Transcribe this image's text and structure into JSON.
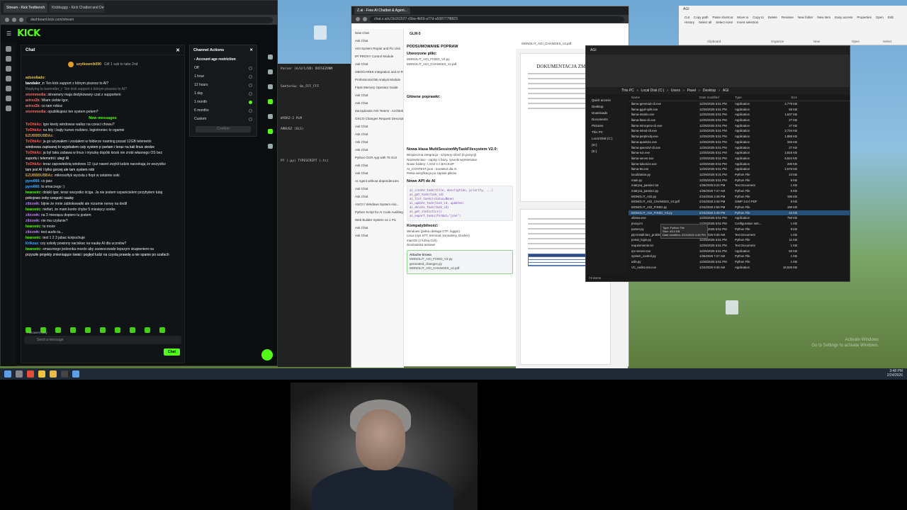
{
  "kick": {
    "tabs": [
      "Stream - Kick Testbench",
      "Kickbuggy - Kick Chatbot and Dev"
    ],
    "address": "dashboard.kick.com/stream",
    "logo": "KICK",
    "chat_title": "Chat",
    "pinned_user": "uzytkownik090",
    "pinned_text": "Gift 1 sub to take 2nd",
    "messages": [
      {
        "user": "adsoo6ado:",
        "text": " ",
        "color": "#e8c84a"
      },
      {
        "user": "bandaler_r:",
        "text": "Ten kick support z którym piszesz to AI?",
        "color": "#ffffff"
      },
      {
        "user": "",
        "text": "Replying to bamndler_r: Ten kick support z którym piszesz to AI?",
        "color": "#888888"
      },
      {
        "user": "stormmedia:",
        "text": "streamery maja dedykowany czat z supportem",
        "color": "#ff6b6b"
      },
      {
        "user": "artrez2b:",
        "text": "Wiam ciebie Igor,",
        "color": "#ff6b6b"
      },
      {
        "user": "artrez2b:",
        "text": "co tam robisz",
        "color": "#ff6b6b"
      },
      {
        "user": "stormmedia:",
        "text": "opublikujesz ten system potem?",
        "color": "#ff6b6b"
      }
    ],
    "new_messages": "New messages",
    "messages2": [
      {
        "user": "ToOhkAz:",
        "text": "Igor kiedy windowse walisz na czesci chowu?",
        "color": "#ff5c5c"
      },
      {
        "user": "ToOhkAz:",
        "text": "na bity i bajty kurwo rozbierz, logiotroniec to ogamie",
        "color": "#ff5c5c"
      },
      {
        "user": "EZUBBBUBBAz:",
        "text": " ",
        "color": "#c8a050"
      },
      {
        "user": "ToOhkAz:",
        "text": "ja go używałem i zostałem w folderze roaming pozad 12GB telemetrii",
        "color": "#ff5c5c"
      },
      {
        "user": "",
        "text": "windowsa zapisanej to wyjebalem caly system p partam i teraz na kali linux siedze",
        "color": "#ffffff"
      },
      {
        "user": "ToOhkAz:",
        "text": "ja byl taka zabawa w linux i myszkę dopóki kiosk nie zrobi własnego OS bez",
        "color": "#ff5c5c"
      },
      {
        "user": "",
        "text": "suportu i telemetrii i uleg! AI",
        "color": "#ffffff"
      },
      {
        "user": "ToOhkAz:",
        "text": "teraz zapowiedzią windows 12 i już nawet zwykli ludzie narzekają że wszystko",
        "color": "#ff5c5c"
      },
      {
        "user": "",
        "text": "tam jest AI i tylko gorzej ale tam system robi",
        "color": "#ffffff"
      },
      {
        "user": "EZUBBBUBBAz:",
        "text": "mikrosoftyk wycisła z fiopt w ostatnie soki",
        "color": "#c8a050"
      },
      {
        "user": "pyro660:",
        "text": "co jasz",
        "color": "#4ab0ff"
      },
      {
        "user": "pyro660:",
        "text": "to smaczego :)",
        "color": "#4ab0ff"
      },
      {
        "user": "lwansnic:",
        "text": "dzięki Igor, teraz wszystko ściga. Ja nie jestem szpanicielem przybytem tutaj",
        "color": "#53fc18"
      },
      {
        "user": "",
        "text": "pokojowo żeby czegość naukę",
        "color": "#ffffff"
      },
      {
        "user": "zibizwik:",
        "text": "bijnie że mnie zablokowalki ale rozumie nerwy na dedil",
        "color": "#b77cff"
      },
      {
        "user": "lwansnic:",
        "text": "niefart, że mam konto chybe 5 miesięcy sonke",
        "color": "#53fc18"
      },
      {
        "user": "zibizwik:",
        "text": "na 3 miesiąca dopiero tu jestem",
        "color": "#b77cff"
      },
      {
        "user": "zibizwik:",
        "text": "nie ma czytanie?",
        "color": "#b77cff"
      },
      {
        "user": "lwansnic:",
        "text": "tu może",
        "color": "#53fc18"
      },
      {
        "user": "zibizwik:",
        "text": "test audio ta...",
        "color": "#b77cff"
      },
      {
        "user": "lwansnic:",
        "text": "test 1 2 3 jabac korpochuje",
        "color": "#53fc18"
      },
      {
        "user": "Krikzuz:",
        "text": "czy szkoły powinny naciskac na naukę AI dla uczniów?",
        "color": "#4ab0ff"
      },
      {
        "user": "lwansnic:",
        "text": "smacznego jedzonka mordo aby zaowocowało lepszym skupieniem na",
        "color": "#53fc18"
      },
      {
        "user": "",
        "text": "przyszłe projekty zmieniające świat i pogłęd ludzi na czystą prawdę a nie spanie po szafach",
        "color": "#ffffff"
      }
    ],
    "followers_only": "Followers only",
    "input_placeholder": "Send a message",
    "chat_button": "Chat",
    "actions_title": "Channel Actions",
    "actions_sub": "Account age restriction",
    "actions": [
      "Off",
      "1 hour",
      "12 hours",
      "1 day",
      "1 month",
      "6 months",
      "Custom"
    ],
    "actions_selected": 4,
    "confirm": "Confirm",
    "save_label": "Save"
  },
  "zai": {
    "title": "Z.ai - Free AI Chatbot & Agent...",
    "address": "chat.z.ai/c/1b161527-c5ba-4b59-a77d-a508777f8823",
    "model": "GLM-5",
    "sidebar": [
      "New Chat",
      "Ask Chat",
      "AGI System Repair and Fix Unit",
      "IP/ PROXY Control Module",
      "Ask Chat",
      "OBOCIAREK Integration and AI Re...",
      "Professional DB Analyst Module",
      "Flask Memory Operator Guide",
      "Ask Chat",
      "Ask Chat",
      "Zarządzanie AGI Teams - Architek...",
      "OSCO Changes Request Descriptor",
      "Ask Chat",
      "Ask Chat",
      "Ask Chat",
      "Ask Chat",
      "Python OCR App with Tk GUI",
      "Ask Chat",
      "Ask Chat",
      "AI Agent without dependencies",
      "Ask Chat",
      "Ask Chat",
      "ASCII / Windows System Ass...",
      "Python Script for AI Code Auditing",
      "Web Builder System v4.1 Pic",
      "Ask Chat",
      "Ask Chat"
    ],
    "h1": "PODSUMOWANIE POPRAW",
    "h2": "Utworzone pliki:",
    "h3": "Główne poprawki:",
    "h4": "Nowa klasa MultiSessionMyTaskFilesystem V2.0:",
    "bullets": [
      "Bezpieczna integracja - sztywny rdzeń (5 pozycji)",
      "Nazewnictwo - zapisy z bazy, rysunki wymieniane",
      "Nowe foldery: /.AGI/ C:\\ BACKUP",
      "AI_CONTEXT.json - kontekst dla AI",
      "Pełna weryfikacja po zapisie plików"
    ],
    "h5": "Nowe API do AI",
    "code": [
      "ai_create_task(title, description, priority, ...)",
      "ai_get_task(task_id)",
      "ai_list_tasks(status=None)",
      "ai_update_task(task_id, updates)",
      "ai_delete_task(task_id)",
      "ai_get_statistics()",
      "ai_export_tasks(format=\"json\")"
    ],
    "h6": "Kompatybilność:",
    "compat": [
      "Windows (pełna obsługa CTF, logger)",
      "Linux (sys STT, terminal, konsoleny, Docker)",
      "macOS (z luźną GUI)",
      "Środowiska testowe"
    ],
    "files_title": "Attache krowa",
    "files": [
      "MONOLIT_AGI_CHANGES_v2.pdf",
      "generated_changes.py",
      "MONOLIT_AGI_FIXED_V2.py"
    ],
    "doc_tab": "MONOLIT_AGI_CHANGES_v2.pdf",
    "doc_title": "DOKUMENTACJA ZMIAN"
  },
  "term": {
    "line1": "Parser (A/U/1/UD) DOISEZONM",
    "line2": "PY (.py) TYPESCRIPT (.ts)",
    "line3": "WYDRZ-2 PLM",
    "line4": "ARKUSZ (XLS)",
    "line5": "Sektorów: 0x_FFF_FFF"
  },
  "explorer": {
    "title": "AGI",
    "path": [
      "This PC",
      "Local Disk (C:)",
      "Users",
      "Pavel",
      "Desktop",
      "AGI"
    ],
    "search": "Search AGI",
    "nav": [
      "Quick access",
      "Desktop",
      "Downloads",
      "Documents",
      "Pictures",
      "This PC",
      "Local Disk (C:)",
      "(D:)",
      "(E:)"
    ],
    "columns": [
      "Name",
      "Date modified",
      "Type",
      "Size"
    ],
    "files": [
      {
        "name": "llama-gemma3-cli.exe",
        "date": "12/25/2025 5:51 PM",
        "type": "Application",
        "size": "2,779 KB"
      },
      {
        "name": "llama-gguf-split.exe",
        "date": "12/25/2025 5:51 PM",
        "type": "Application",
        "size": "59 KB"
      },
      {
        "name": "llama-imatrix.exe",
        "date": "12/25/2025 5:51 PM",
        "type": "Application",
        "size": "1,637 KB"
      },
      {
        "name": "llama-llava-cli.exe",
        "date": "12/25/2025 5:51 PM",
        "type": "Application",
        "size": "27 KB"
      },
      {
        "name": "llama-minicpmv-cli.exe",
        "date": "12/25/2025 5:51 PM",
        "type": "Application",
        "size": "27 KB"
      },
      {
        "name": "llama-mtmd-cli.exe",
        "date": "12/25/2025 5:51 PM",
        "type": "Application",
        "size": "2,734 KB"
      },
      {
        "name": "llama-perplexity.exe",
        "date": "12/25/2025 5:51 PM",
        "type": "Application",
        "size": "1,888 KB"
      },
      {
        "name": "llama-quantize.exe",
        "date": "12/25/2025 5:51 PM",
        "type": "Application",
        "size": "345 KB"
      },
      {
        "name": "llama-qwen2vl-cli.exe",
        "date": "12/25/2025 5:51 PM",
        "type": "Application",
        "size": "27 KB"
      },
      {
        "name": "llama-run.exe",
        "date": "12/25/2025 5:51 PM",
        "type": "Application",
        "size": "2,816 KB"
      },
      {
        "name": "llama-server.exe",
        "date": "12/25/2025 5:51 PM",
        "type": "Application",
        "size": "5,624 KB"
      },
      {
        "name": "llama-tokenize.exe",
        "date": "12/25/2025 5:51 PM",
        "type": "Application",
        "size": "200 KB"
      },
      {
        "name": "llama-tts.exe",
        "date": "12/25/2025 5:51 PM",
        "type": "Application",
        "size": "2,579 KB"
      },
      {
        "name": "localization.py",
        "date": "12/29/2025 9:31 PM",
        "type": "Python File",
        "size": "24 KB"
      },
      {
        "name": "main.py",
        "date": "12/25/2025 5:51 PM",
        "type": "Python File",
        "size": "8 KB"
      },
      {
        "name": "matryca_pamieci.txt",
        "date": "1/26/2026 8:24 PM",
        "type": "Text Document",
        "size": "1 KB"
      },
      {
        "name": "matryca_pamieci.py",
        "date": "1/26/2026 7:27 AM",
        "type": "Python File",
        "size": "5 KB"
      },
      {
        "name": "MONOLIT_AGI.py",
        "date": "2/24/2026 3:48 PM",
        "type": "Python File",
        "size": "196 KB"
      },
      {
        "name": "MONOLIT_AGI_CHANGES_V2.pdf",
        "date": "2/24/2026 3:48 PM",
        "type": "GIMP 3.0.0 PDF",
        "size": "9 KB"
      },
      {
        "name": "MONOLIT_AGI_FIXED.py",
        "date": "2/24/2026 2:58 PM",
        "type": "Python File",
        "size": "196 KB"
      },
      {
        "name": "MONOLIT_AGI_FIXED_V2.py",
        "date": "2/24/2026 3:48 PM",
        "type": "Python File",
        "size": "43 KB"
      },
      {
        "name": "ollama.exe",
        "date": "12/25/2025 5:51 PM",
        "type": "Application",
        "size": "750 KB"
      },
      {
        "name": "proxy.ini",
        "date": "12/25/2025 5:51 PM",
        "type": "Configuration sett...",
        "size": "1 KB"
      },
      {
        "name": "parser.py",
        "date": "12/25/2025 5:51 PM",
        "type": "Python File",
        "size": "8 KB"
      },
      {
        "name": "pip-install-bez_problemy.txt",
        "date": "2/18/2026 9:36 AM",
        "type": "Text Document",
        "size": "1 KB"
      },
      {
        "name": "portal_login.py",
        "date": "12/25/2025 5:51 PM",
        "type": "Python File",
        "size": "11 KB"
      },
      {
        "name": "requirements.txt",
        "date": "12/25/2025 5:51 PM",
        "type": "Text Document",
        "size": "1 KB"
      },
      {
        "name": "rpc-server.exe",
        "date": "12/25/2025 5:51 PM",
        "type": "Application",
        "size": "60 KB"
      },
      {
        "name": "system_control.py",
        "date": "1/26/2026 7:27 AM",
        "type": "Python File",
        "size": "1 KB"
      },
      {
        "name": "utils.py",
        "date": "12/25/2025 5:51 PM",
        "type": "Python File",
        "size": "1 KB"
      },
      {
        "name": "VC_redist.x64.exe",
        "date": "1/24/2026 9:46 AM",
        "type": "Application",
        "size": "18,526 KB"
      }
    ],
    "selected_index": 20,
    "tooltip": [
      "Type: Python File",
      "Size: 43.0 KB",
      "Date modified: 2/24/2026 3:48 PM"
    ],
    "status": "72 items"
  },
  "ribbon": {
    "title": "AGI",
    "groups": [
      "Clipboard",
      "Organize",
      "New",
      "Open",
      "Select"
    ],
    "items": [
      "Cut",
      "Copy path",
      "Paste shortcut",
      "Move to",
      "Copy to",
      "Delete",
      "Rename",
      "New folder",
      "New item",
      "Easy access",
      "Properties",
      "Open",
      "Edit",
      "History",
      "Select all",
      "Select none",
      "Invert selection"
    ]
  },
  "taskbar": {
    "time": "3:48 PM",
    "date": "2/24/2026"
  },
  "watermark": [
    "Activate Windows",
    "Go to Settings to activate Windows."
  ]
}
